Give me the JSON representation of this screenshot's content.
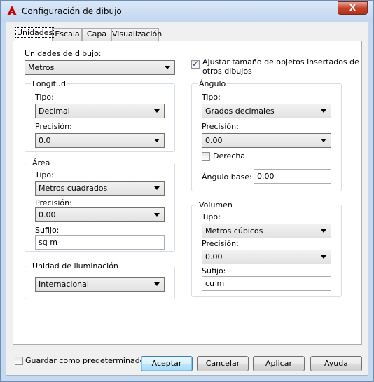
{
  "window": {
    "title": "Configuración de dibujo",
    "close_glyph": "X"
  },
  "tabs": [
    "Unidades",
    "Escala",
    "Capa",
    "Visualización"
  ],
  "units": {
    "drawing_units_label": "Unidades de dibujo:",
    "drawing_units_value": "Metros",
    "scale_inserted_label": "Ajustar tamaño de objetos insertados de otros dibujos",
    "scale_inserted_checked": true
  },
  "length": {
    "title": "Longitud",
    "type_label": "Tipo:",
    "type_value": "Decimal",
    "precision_label": "Precisión:",
    "precision_value": "0.0"
  },
  "angle": {
    "title": "Ángulo",
    "type_label": "Tipo:",
    "type_value": "Grados decimales",
    "precision_label": "Precisión:",
    "precision_value": "0.00",
    "clockwise_label": "Derecha",
    "clockwise_checked": false,
    "base_label": "Ángulo base:",
    "base_value": "0.00"
  },
  "area": {
    "title": "Área",
    "type_label": "Tipo:",
    "type_value": "Metros cuadrados",
    "precision_label": "Precisión:",
    "precision_value": "0.00",
    "suffix_label": "Sufijo:",
    "suffix_value": "sq m"
  },
  "volume": {
    "title": "Volumen",
    "type_label": "Tipo:",
    "type_value": "Metros cúbicos",
    "precision_label": "Precisión:",
    "precision_value": "0.00",
    "suffix_label": "Sufijo:",
    "suffix_value": "cu m"
  },
  "lighting": {
    "title": "Unidad de iluminación",
    "value": "Internacional"
  },
  "footer": {
    "save_default_label": "Guardar como predeterminado",
    "save_default_checked": false,
    "ok": "Aceptar",
    "cancel": "Cancelar",
    "apply": "Aplicar",
    "help": "Ayuda"
  },
  "colors": {
    "accent": "#3c7fb1",
    "close": "#c4432b",
    "app_icon": "#cc0000"
  }
}
